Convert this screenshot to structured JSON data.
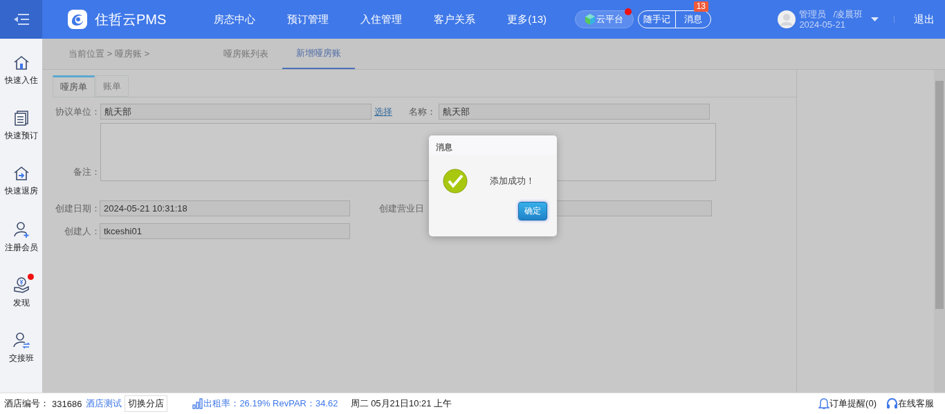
{
  "header": {
    "logo": "住哲云PMS",
    "nav": [
      {
        "label": "房态中心"
      },
      {
        "label": "预订管理"
      },
      {
        "label": "入住管理"
      },
      {
        "label": "客户关系"
      },
      {
        "label": "更多(13)"
      }
    ],
    "cloud": {
      "label": "云平台",
      "notify": true
    },
    "notes_button": "随手记",
    "messages": {
      "label": "消息",
      "badge": "13"
    },
    "user": {
      "name": "管理员",
      "shift": "/凌晨班",
      "date": "2024-05-21"
    },
    "logout": "退出"
  },
  "sidebar": {
    "items": [
      {
        "label": "快速入住",
        "notify": false
      },
      {
        "label": "快速预订",
        "notify": false
      },
      {
        "label": "快速退房",
        "notify": false
      },
      {
        "label": "注册会员",
        "notify": false
      },
      {
        "label": "发现",
        "notify": true
      },
      {
        "label": "交接班",
        "notify": false
      }
    ]
  },
  "breadcrumb": "当前位置 > 哑房账 >",
  "page_tabs": [
    {
      "label": "哑房账列表",
      "selected": false
    },
    {
      "label": "新增哑房账",
      "selected": true
    }
  ],
  "form_tabs": [
    {
      "label": "哑房单",
      "selected": true
    },
    {
      "label": "账单",
      "selected": false
    }
  ],
  "form": {
    "agreement_unit": {
      "label": "协议单位：",
      "value": "航天部"
    },
    "select_link": "选择",
    "name": {
      "label": "名称：",
      "value": "航天部"
    },
    "remarks": {
      "label": "备注："
    },
    "created_date": {
      "label": "创建日期：",
      "value": "2024-05-21 10:31:18"
    },
    "business_date": {
      "label": "创建营业日"
    },
    "creator": {
      "label": "创建人：",
      "value": "tkceshi01"
    }
  },
  "dialog": {
    "title": "消息",
    "message": "添加成功！",
    "ok": "确定"
  },
  "status_bar": {
    "hotel_no_label": "酒店编号：",
    "hotel_no": "331686",
    "hotel_name": "酒店测试",
    "switch": "切换分店",
    "occupancy": "出租率：26.19% RevPAR：34.62",
    "datetime": "周二 05月21日10:21 上午",
    "order_alert": "订单提醒(0)",
    "service": "在线客服"
  }
}
